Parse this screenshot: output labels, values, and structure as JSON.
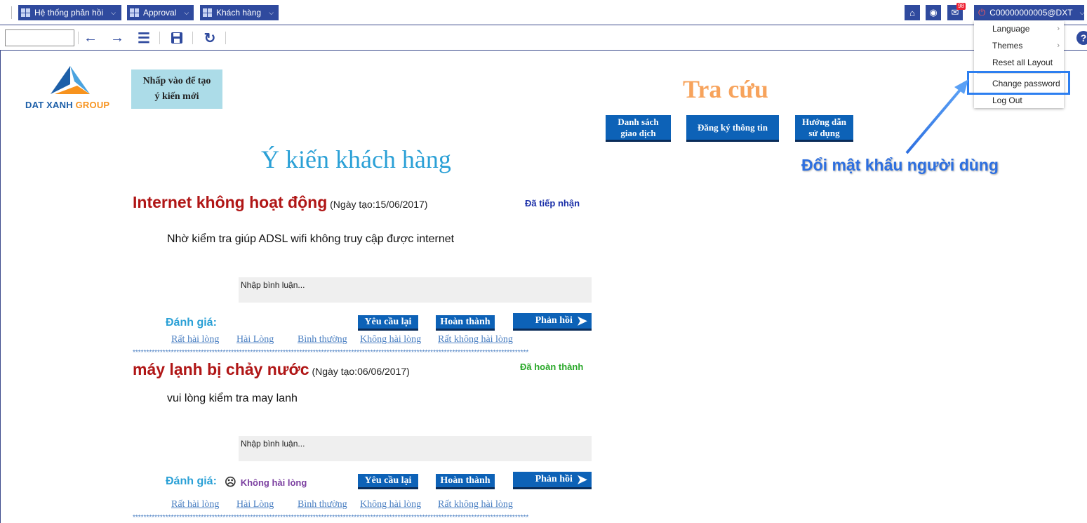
{
  "topbar": {
    "menus": [
      {
        "label": "Hệ thống phản hồi"
      },
      {
        "label": "Approval"
      },
      {
        "label": "Khách hàng"
      }
    ],
    "notification_count": "98",
    "user_label": "C00000000005@DXT"
  },
  "toolbar": {
    "search_value": "",
    "icons": [
      "back-arrow-icon",
      "forward-arrow-icon",
      "list-icon",
      "save-icon",
      "refresh-icon",
      "help-icon"
    ]
  },
  "logo": {
    "brand": "DAT XANH",
    "suffix": " GROUP"
  },
  "new_opinion_label": "Nhấp vào để tạo\ný kiến mới",
  "tra_cuu": "Tra cứu",
  "nav_buttons": [
    {
      "label": "Danh sách\ngiao dịch"
    },
    {
      "label": "Đăng ký thông tin"
    },
    {
      "label": "Hướng dẫn\nsử dụng"
    }
  ],
  "page_heading": "Ý kiến khách hàng",
  "feedbacks": [
    {
      "title": "Internet không hoạt động",
      "date": " (Ngày tạo:15/06/2017)",
      "status": "Đã tiếp nhận",
      "status_color": "#1a2fa8",
      "content": "Nhờ kiểm tra giúp ADSL wifi không truy cập được internet",
      "comment_placeholder": "Nhập bình luận...",
      "rating_label": "Đánh giá:",
      "rating_value": ""
    },
    {
      "title": "máy lạnh bị chảy nước",
      "date": " (Ngày tạo:06/06/2017)",
      "status": "Đã hoàn thành",
      "status_color": "#2aa82a",
      "content": "vui lòng kiểm tra may lanh",
      "comment_placeholder": "Nhập bình luận...",
      "rating_label": "Đánh giá:",
      "rating_value": "Không hài lòng"
    }
  ],
  "actions": {
    "retry": "Yêu cầu lại",
    "complete": "Hoàn thành",
    "reply": "Phản hồi"
  },
  "rating_options": [
    "Rất hài lòng",
    "Hài Lòng",
    "Bình thường",
    "Không hài lòng",
    "Rất không hài lòng"
  ],
  "separator": "*************************************************************************************************************************************************",
  "dropdown": {
    "items": [
      {
        "label": "Language",
        "submenu": true
      },
      {
        "label": "Themes",
        "submenu": true
      },
      {
        "label": "Reset all Layout",
        "submenu": false
      },
      {
        "label": "Change password",
        "submenu": false
      },
      {
        "label": "Log Out",
        "submenu": false
      }
    ]
  },
  "callout_text": "Đổi mật khẩu người dùng"
}
